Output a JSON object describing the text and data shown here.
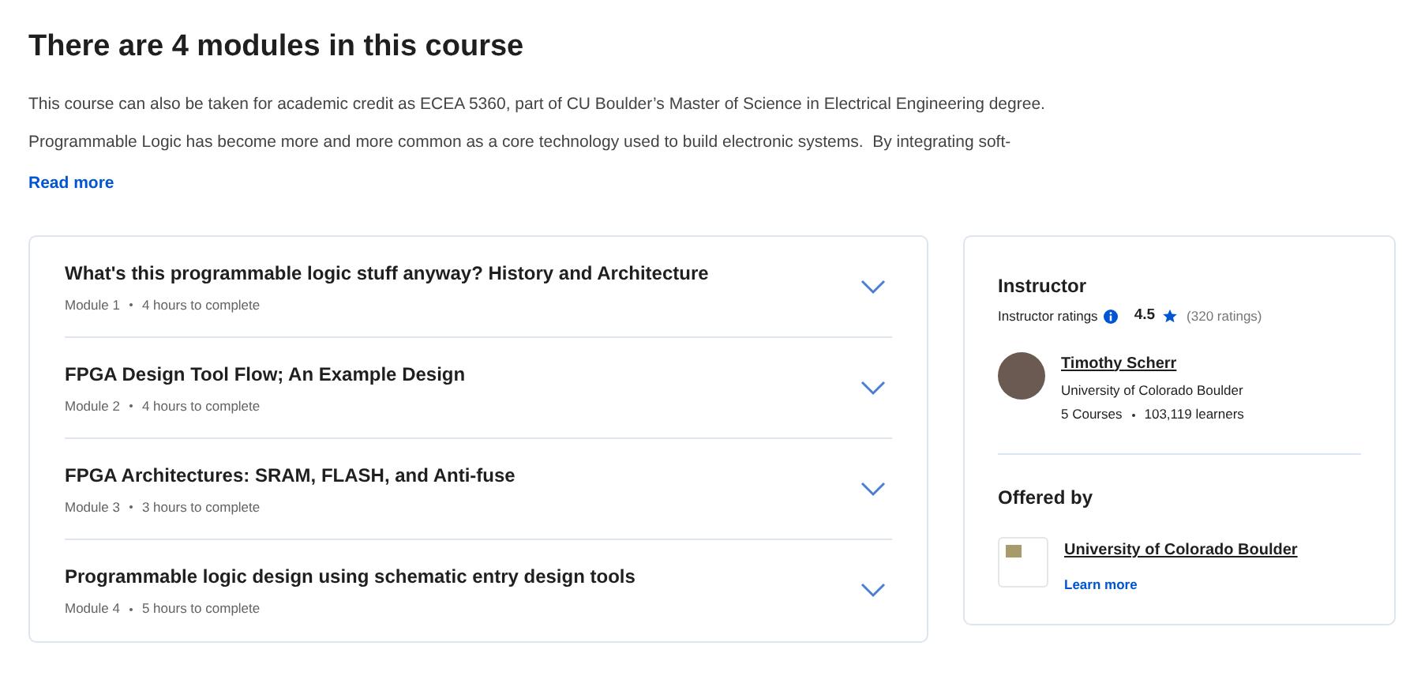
{
  "heading": "There are 4 modules in this course",
  "paragraphs": [
    "This course can also be taken for academic credit as ECEA 5360, part of CU Boulder’s Master of Science in Electrical Engineering degree.",
    "Programmable Logic has become more and more common as a core technology used to build electronic systems.  By integrating soft-"
  ],
  "read_more": "Read more",
  "modules": [
    {
      "title": "What's this programmable logic stuff anyway? History and Architecture",
      "number": "Module 1",
      "duration": "4 hours to complete",
      "expanded": false
    },
    {
      "title": "FPGA Design Tool Flow; An Example Design",
      "number": "Module 2",
      "duration": "4 hours to complete",
      "expanded": false
    },
    {
      "title": "FPGA Architectures: SRAM, FLASH, and Anti-fuse",
      "number": "Module 3",
      "duration": "3 hours to complete",
      "expanded": false
    },
    {
      "title": "Programmable logic design using schematic entry design tools",
      "number": "Module 4",
      "duration": "5 hours to complete",
      "expanded": false
    }
  ],
  "instructor": {
    "heading": "Instructor",
    "ratings_label": "Instructor ratings",
    "rating": "4.5",
    "rating_count": "(320 ratings)",
    "name": "Timothy Scherr",
    "affiliation": "University of Colorado Boulder",
    "courses": "5 Courses",
    "learners": "103,119 learners"
  },
  "offered_by": {
    "heading": "Offered by",
    "name": "University of Colorado Boulder",
    "learn_more": "Learn more"
  }
}
